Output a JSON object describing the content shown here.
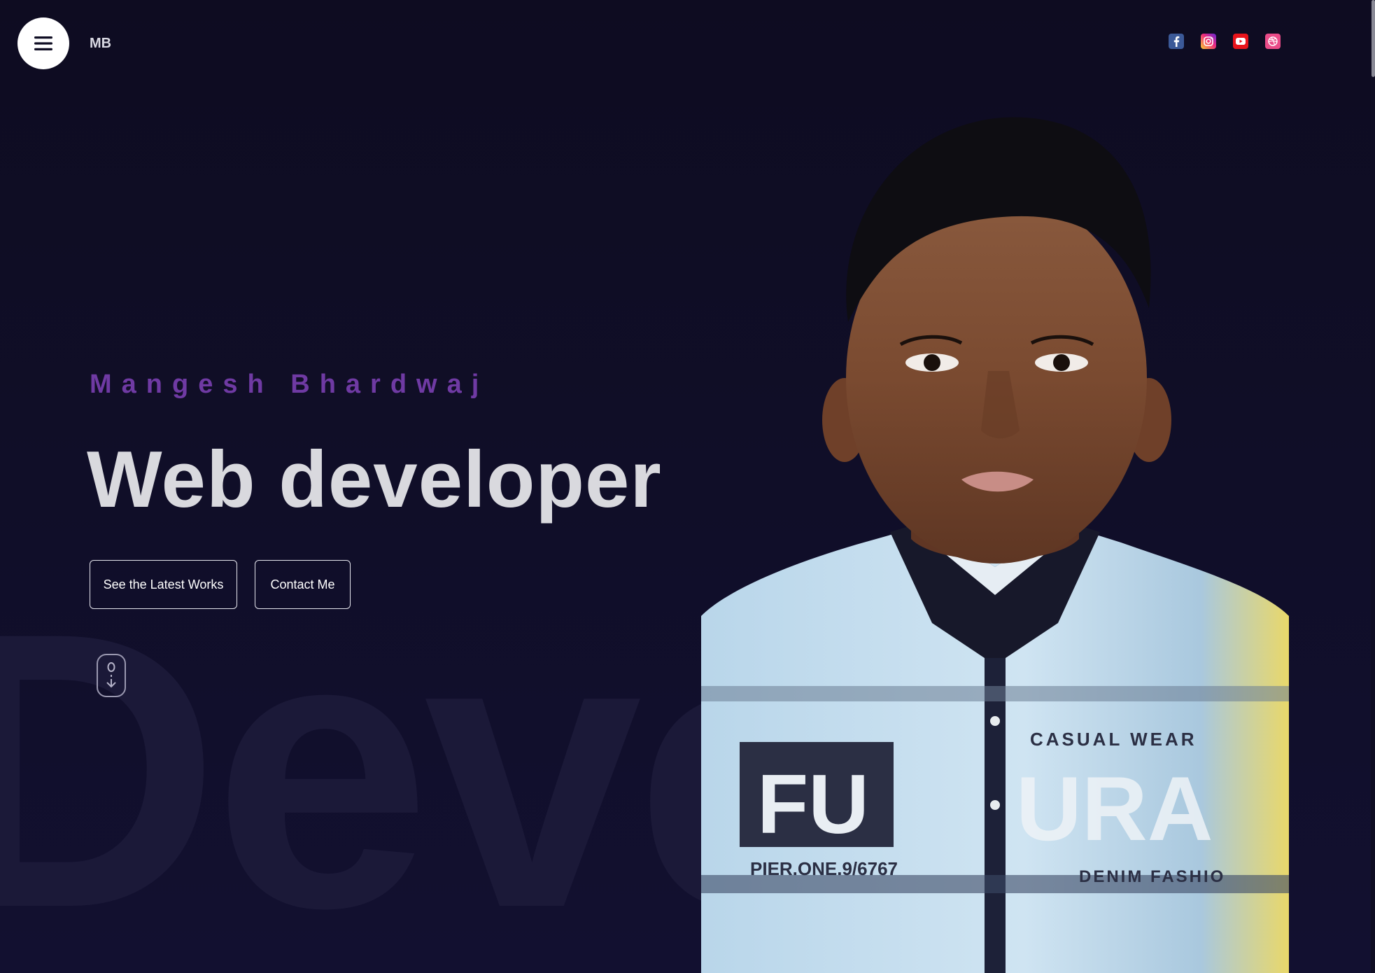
{
  "header": {
    "logo_text": "MB",
    "menu_icon": "hamburger-menu-icon",
    "social_icons": [
      "facebook-icon",
      "instagram-icon",
      "youtube-icon",
      "dribbble-icon"
    ]
  },
  "hero": {
    "name": "Mangesh Bhardwaj",
    "title": "Web developer",
    "buttons": {
      "latest_works": "See the Latest Works",
      "contact": "Contact Me"
    },
    "background_word": "Deve",
    "scroll_icon": "mouse-scroll-down-icon",
    "portrait_image": "portrait-photo"
  },
  "colors": {
    "background": "#0f0d23",
    "accent_name": "#6f3aa3",
    "title_text": "#d9d9de",
    "facebook": "#3b5998",
    "youtube": "#e8141b",
    "dribbble": "#ea4c89"
  }
}
